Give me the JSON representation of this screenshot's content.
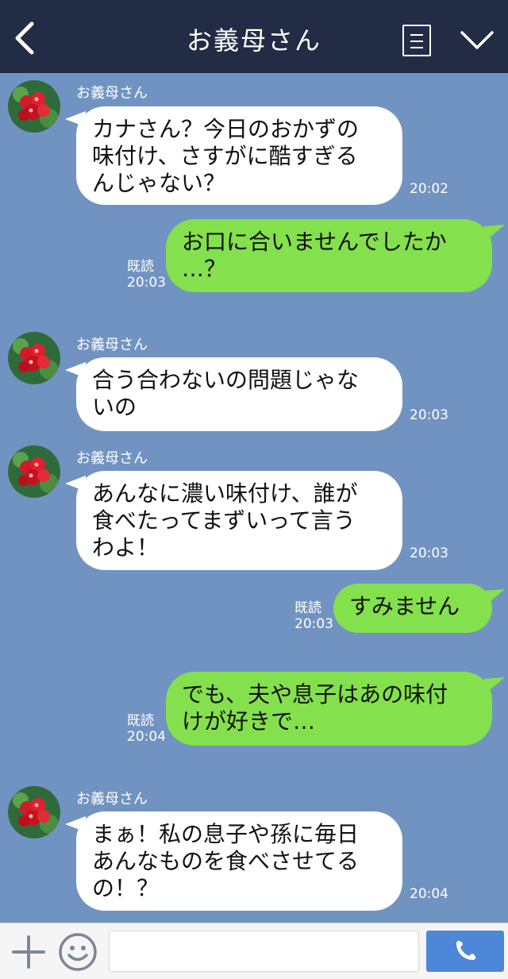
{
  "header": {
    "title": "お義母さん",
    "icons": [
      "back-arrow-icon",
      "menu-list-icon",
      "chevron-down-icon"
    ]
  },
  "messages": [
    {
      "side": "in",
      "sender": "お義母さん",
      "lines": [
        "カナさん？今日のおかずの",
        "味付け、さすがに酷すぎる",
        "んじゃない？"
      ],
      "time": "20:02"
    },
    {
      "side": "out",
      "lines": [
        "お口に合いませんでしたか",
        "…？"
      ],
      "read": "既読",
      "time": "20:03"
    },
    {
      "side": "in",
      "sender": "お義母さん",
      "lines": [
        "合う合わないの問題じゃな",
        "いの"
      ],
      "time": "20:03"
    },
    {
      "side": "in",
      "sender": "お義母さん",
      "lines": [
        "あんなに濃い味付け、誰が",
        "食べたってまずいって言う",
        "わよ！"
      ],
      "time": "20:03"
    },
    {
      "side": "out",
      "lines": [
        "すみません"
      ],
      "read": "既読",
      "time": "20:03"
    },
    {
      "side": "out",
      "lines": [
        "でも、夫や息子はあの味付",
        "けが好きで…"
      ],
      "read": "既読",
      "time": "20:04"
    },
    {
      "side": "in",
      "sender": "お義母さん",
      "lines": [
        "まぁ！私の息子や孫に毎日",
        "あんなものを食べさせてる",
        "の！？"
      ],
      "time": "20:04"
    }
  ],
  "footer": {
    "input_value": "",
    "icons": [
      "plus-icon",
      "smiley-icon",
      "phone-icon"
    ]
  },
  "colors": {
    "background": "#7193c1",
    "header": "#232c45",
    "incoming": "#ffffff",
    "outgoing": "#84e04c",
    "call_button": "#4e86d8"
  }
}
